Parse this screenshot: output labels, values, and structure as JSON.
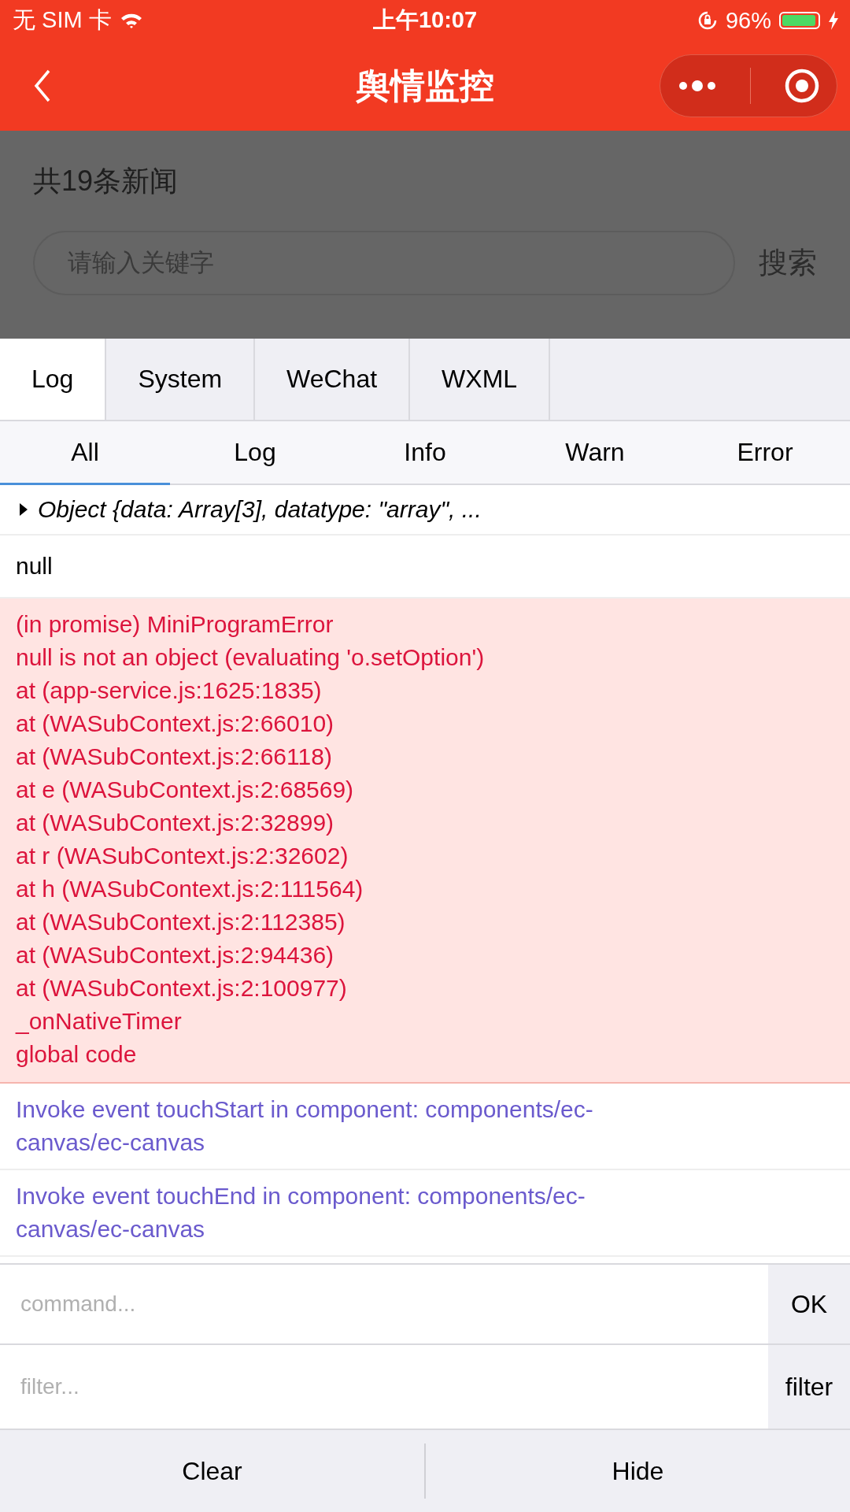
{
  "status_bar": {
    "carrier": "无 SIM 卡",
    "time": "上午10:07",
    "battery": "96%",
    "battery_meter": {
      "level": 0.96
    }
  },
  "nav_bar": {
    "title": "舆情监控"
  },
  "page": {
    "count": "共19条新闻",
    "search": {
      "placeholder": "请输入关键字"
    },
    "search_button": "搜索"
  },
  "console": {
    "tabs": [
      {
        "label": "Log",
        "selected": true
      },
      {
        "label": "System",
        "selected": false
      },
      {
        "label": "WeChat",
        "selected": false
      },
      {
        "label": "WXML",
        "selected": false
      }
    ],
    "filters": [
      {
        "label": "All",
        "selected": true
      },
      {
        "label": "Log",
        "selected": false
      },
      {
        "label": "Info",
        "selected": false
      },
      {
        "label": "Warn",
        "selected": false
      },
      {
        "label": "Error",
        "selected": false
      }
    ],
    "entries": [
      {
        "kind": "object",
        "lines": [
          "Object {data: Array[3], datatype: \"array\", ..."
        ]
      },
      {
        "kind": "log",
        "lines": [
          "null"
        ]
      },
      {
        "kind": "error",
        "lines": [
          "(in promise) MiniProgramError",
          "null is not an object (evaluating 'o.setOption')",
          "at (app-service.js:1625:1835)",
          "at (WASubContext.js:2:66010)",
          "at (WASubContext.js:2:66118)",
          "at e (WASubContext.js:2:68569)",
          "at (WASubContext.js:2:32899)",
          "at r (WASubContext.js:2:32602)",
          "at h (WASubContext.js:2:111564)",
          "at (WASubContext.js:2:112385)",
          "at (WASubContext.js:2:94436)",
          "at (WASubContext.js:2:100977)",
          "_onNativeTimer",
          "global code"
        ]
      },
      {
        "kind": "info",
        "lines": [
          "Invoke event touchStart in component: components/ec-canvas/ec-canvas"
        ]
      },
      {
        "kind": "info",
        "lines": [
          "Invoke event touchEnd in component: components/ec-canvas/ec-canvas"
        ]
      }
    ],
    "command": {
      "placeholder": "command...",
      "button": "OK"
    },
    "filter": {
      "placeholder": "filter...",
      "button": "filter"
    },
    "buttons": [
      "Clear",
      "Hide"
    ]
  }
}
